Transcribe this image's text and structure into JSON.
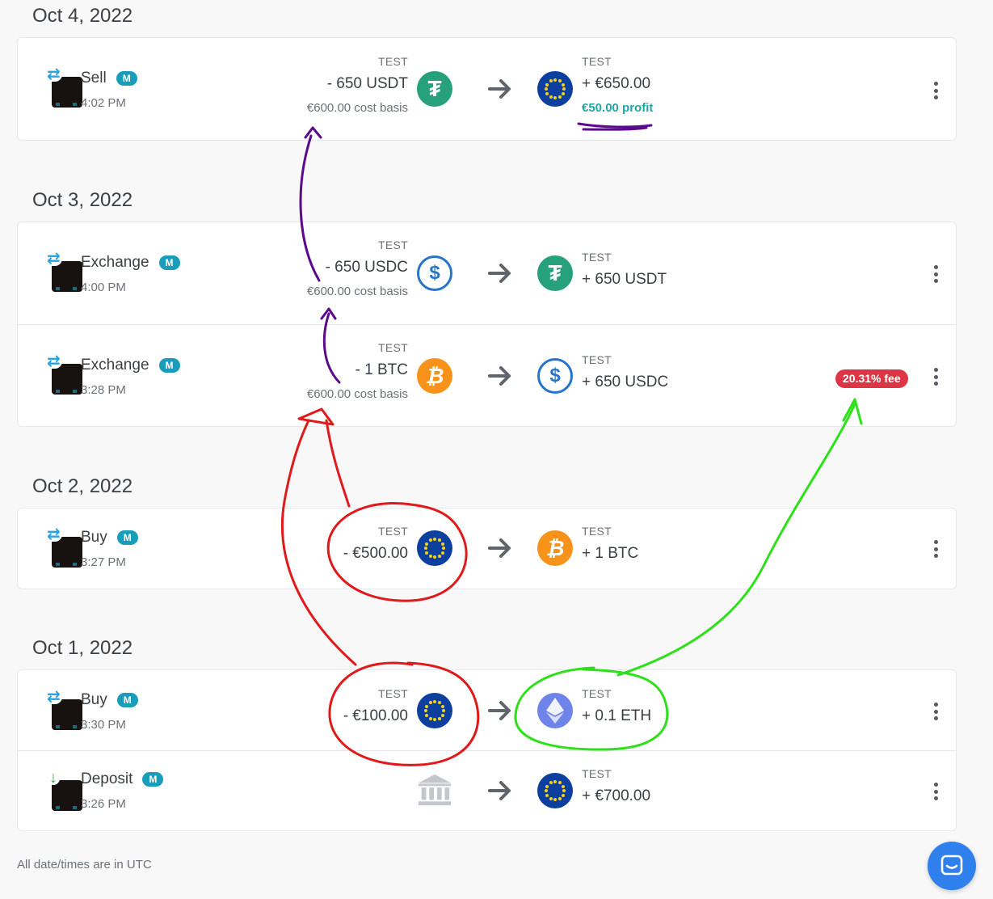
{
  "groups": [
    {
      "date": "Oct 4, 2022",
      "rows": [
        {
          "type": "Sell",
          "badge": "M",
          "time": "4:02 PM",
          "from_label": "TEST",
          "from_amount": "- 650 USDT",
          "from_sub": "€600.00 cost basis",
          "from_icon": "usdt-icon",
          "to_label": "TEST",
          "to_amount": "+ €650.00",
          "to_sub": "€50.00 profit",
          "to_icon": "eur-icon"
        }
      ]
    },
    {
      "date": "Oct 3, 2022",
      "rows": [
        {
          "type": "Exchange",
          "badge": "M",
          "time": "4:00 PM",
          "from_label": "TEST",
          "from_amount": "- 650 USDC",
          "from_sub": "€600.00 cost basis",
          "from_icon": "usdc-icon",
          "to_label": "TEST",
          "to_amount": "+ 650 USDT",
          "to_icon": "usdt-icon"
        },
        {
          "type": "Exchange",
          "badge": "M",
          "time": "3:28 PM",
          "from_label": "TEST",
          "from_amount": "- 1 BTC",
          "from_sub": "€600.00 cost basis",
          "from_icon": "btc-icon",
          "to_label": "TEST",
          "to_amount": "+ 650 USDC",
          "to_icon": "usdc-icon",
          "fee": "20.31% fee"
        }
      ]
    },
    {
      "date": "Oct 2, 2022",
      "rows": [
        {
          "type": "Buy",
          "badge": "M",
          "time": "3:27 PM",
          "from_label": "TEST",
          "from_amount": "- €500.00",
          "from_icon": "eur-icon",
          "to_label": "TEST",
          "to_amount": "+ 1 BTC",
          "to_icon": "btc-icon"
        }
      ]
    },
    {
      "date": "Oct 1, 2022",
      "rows": [
        {
          "type": "Buy",
          "badge": "M",
          "time": "3:30 PM",
          "from_label": "TEST",
          "from_amount": "- €100.00",
          "from_icon": "eur-icon",
          "to_label": "TEST",
          "to_amount": "+ 0.1 ETH",
          "to_icon": "eth-icon"
        },
        {
          "type": "Deposit",
          "badge": "M",
          "time": "3:26 PM",
          "from_icon": "bank-icon",
          "to_label": "TEST",
          "to_amount": "+ €700.00",
          "to_icon": "eur-icon"
        }
      ]
    }
  ],
  "footer": {
    "note": "All date/times are in UTC"
  },
  "colors": {
    "accent_badge": "#1a9db8",
    "profit": "#20a6a6",
    "fee": "#dc3545",
    "annotation_purple": "#5a0a8a",
    "annotation_red": "#e01a1a",
    "annotation_green": "#2ee01a"
  }
}
